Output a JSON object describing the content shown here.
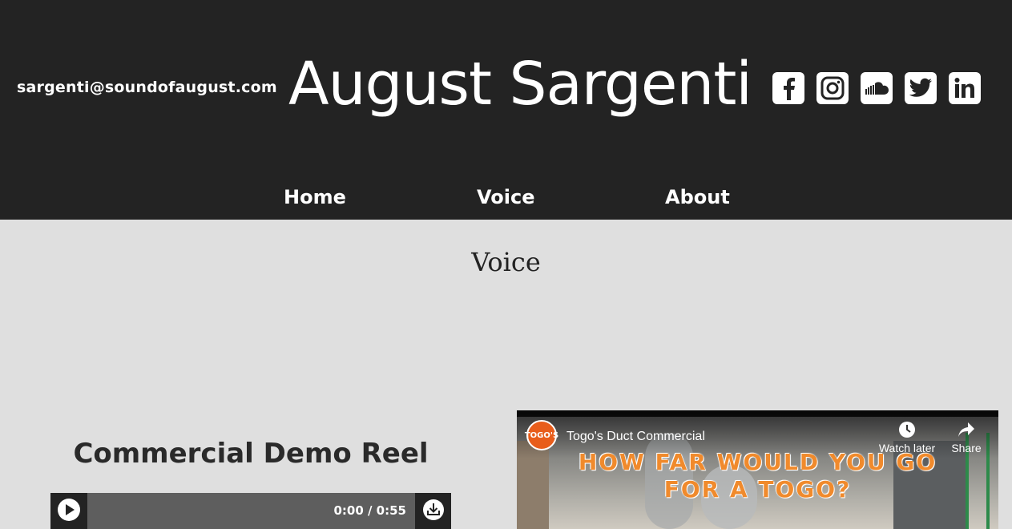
{
  "header": {
    "email": "sargenti@soundofaugust.com",
    "site_title": "August Sargenti",
    "social": [
      {
        "name": "facebook",
        "icon": "facebook-icon"
      },
      {
        "name": "instagram",
        "icon": "instagram-icon"
      },
      {
        "name": "soundcloud",
        "icon": "soundcloud-icon"
      },
      {
        "name": "twitter",
        "icon": "twitter-icon"
      },
      {
        "name": "linkedin",
        "icon": "linkedin-icon"
      }
    ]
  },
  "nav": {
    "items": [
      "Home",
      "Voice",
      "About"
    ]
  },
  "page": {
    "heading": "Voice"
  },
  "reel": {
    "title": "Commercial Demo Reel",
    "player_time": "0:00 / 0:55"
  },
  "video": {
    "channel_logo_text": "TOGO'S",
    "title": "Togo's Duct Commercial",
    "watch_later": "Watch later",
    "share": "Share",
    "overlay_line1": "HOW FAR WOULD YOU GO",
    "overlay_line2": "FOR A TOGO?"
  },
  "colors": {
    "header_bg": "#232323",
    "body_bg": "#dfdfdf",
    "overlay_orange": "#f08a2c"
  }
}
